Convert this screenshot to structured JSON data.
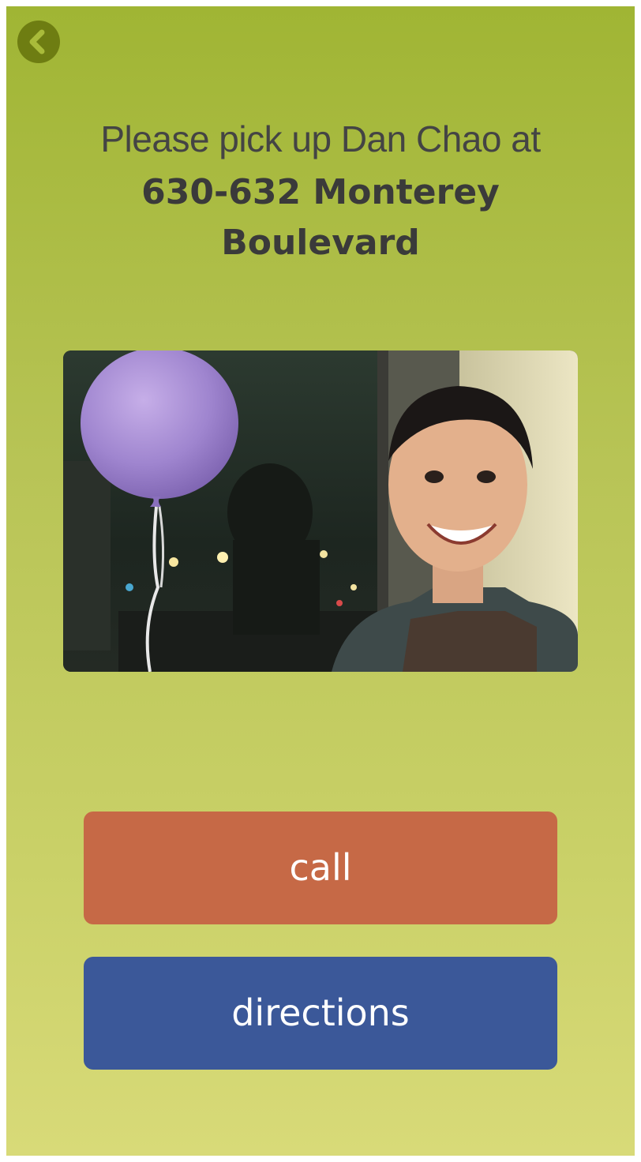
{
  "header": {
    "back_icon": "chevron-left-icon",
    "prompt": "Please pick up Dan Chao at",
    "address": "630-632 Monterey Boulevard"
  },
  "photo": {
    "subject": "Dan Chao"
  },
  "actions": {
    "call_label": "call",
    "directions_label": "directions"
  },
  "colors": {
    "background_top": "#a0b534",
    "background_bottom": "#d8da78",
    "back_button": "#6e7d12",
    "call_button": "#c66946",
    "directions_button": "#3b5899",
    "headline_text": "#3d3d3d"
  }
}
